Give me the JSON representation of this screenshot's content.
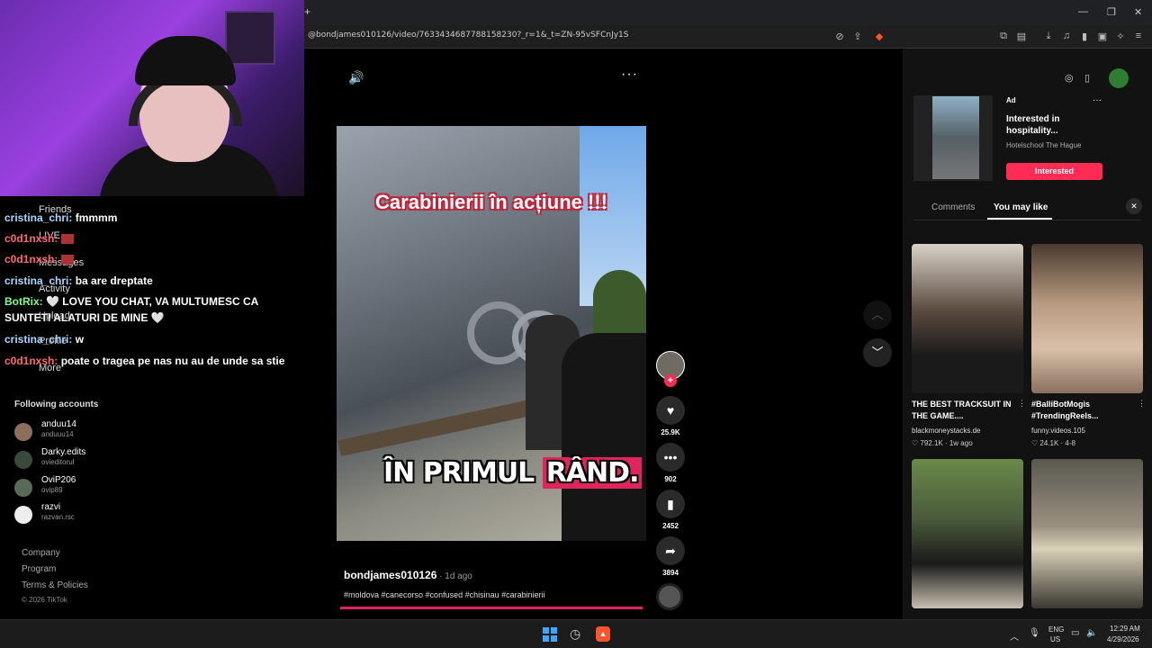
{
  "browser": {
    "url": "@bondjames010126/video/7633434687788158230?_r=1&_t=ZN-95vSFCnJy1S",
    "new_tab_icon": "plus-icon"
  },
  "chat": {
    "lines": [
      {
        "user": "cristina_chri:",
        "msg": "fmmmm"
      },
      {
        "user": "c0d1nxsh:",
        "msg": ""
      },
      {
        "user": "c0d1nxsh:",
        "msg": ""
      },
      {
        "user": "cristina_chri:",
        "msg": "ba are dreptate"
      },
      {
        "user": "BotRix:",
        "msg": "🤍 LOVE YOU CHAT, VA MULTUMESC CA"
      },
      {
        "user": "",
        "msg": "SUNTETI ALATURI DE MINE 🤍"
      },
      {
        "user": "cristina_chri:",
        "msg": "w"
      },
      {
        "user": "c0d1nxsh:",
        "msg": "poate o tragea pe nas nu au de unde sa stie"
      }
    ]
  },
  "tiktok_nav": {
    "items": [
      "Friends",
      "LIVE",
      "Messages",
      "Activity",
      "Upload",
      "Profile",
      "More"
    ],
    "following_title": "Following accounts",
    "accounts": [
      {
        "name": "anduu14",
        "handle": "anduuu14"
      },
      {
        "name": "Darky.edits",
        "handle": "ovieditorul"
      },
      {
        "name": "OviP206",
        "handle": "ovip89"
      },
      {
        "name": "razvi",
        "handle": "razvan.rsc"
      }
    ],
    "footer": [
      "Company",
      "Program",
      "Terms & Policies",
      "© 2026 TikTok"
    ]
  },
  "video": {
    "caption_top": "Carabinierii în acțiune !!!",
    "caption_bottom_a": "ÎN PRIMUL ",
    "caption_bottom_b": "RÂND.",
    "author": "bondjames010126",
    "time": " · 1d ago",
    "tags": "#moldova #canecorso #confused #chisinau #carabinierii",
    "progress": 1.0
  },
  "actions": {
    "likes": "25.9K",
    "comments": "902",
    "saves": "2452",
    "shares": "3894"
  },
  "ad": {
    "label": "Ad",
    "title": "Interested in hospitality...",
    "sponsor": "Hotelschool The Hague",
    "button": "Interested"
  },
  "tabs": {
    "comments": "Comments",
    "you_may_like": "You may like"
  },
  "recommendations": [
    {
      "title": "THE BEST TRACKSUIT IN THE GAME....",
      "author": "blackmoneystacks.de",
      "stats": "♡ 792.1K · 1w ago"
    },
    {
      "title": "#BalliBotMogis #TrendingReels...",
      "author": "funny.videos.105",
      "stats": "♡ 24.1K · 4-8"
    },
    {
      "title": "",
      "author": "",
      "stats": ""
    },
    {
      "title": "",
      "author": "",
      "stats": ""
    }
  ],
  "taskbar": {
    "lang1": "ENG",
    "lang2": "US",
    "time": "12:29 AM",
    "date": "4/29/2026"
  }
}
